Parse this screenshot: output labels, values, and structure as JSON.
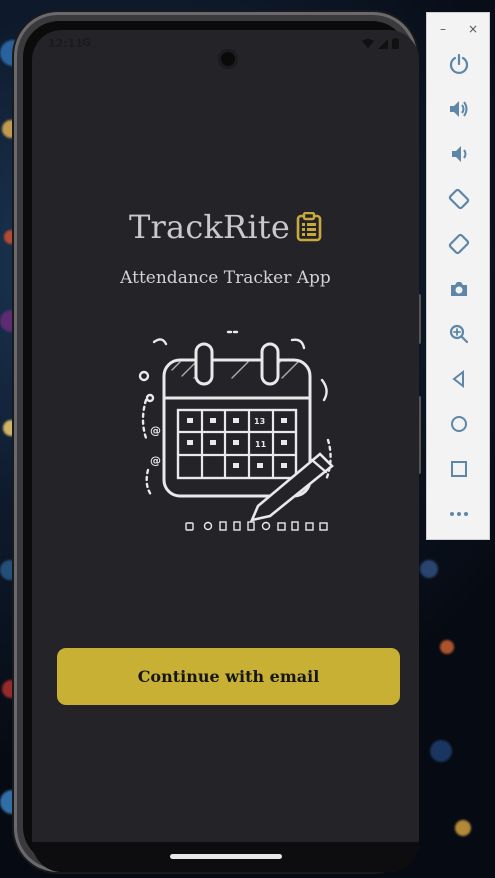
{
  "status": {
    "time": "12:11",
    "g_label": "G"
  },
  "app": {
    "title": "TrackRite",
    "subtitle": "Attendance Tracker App",
    "cta_label": "Continue with email",
    "calendar_numbers": [
      "13",
      "11"
    ]
  },
  "emulator": {
    "minimize_label": "–",
    "close_label": "×",
    "controls": [
      "power-icon",
      "volume-up-icon",
      "volume-down-icon",
      "rotate-left-icon",
      "rotate-right-icon",
      "camera-icon",
      "zoom-icon",
      "back-icon",
      "home-icon",
      "overview-icon",
      "more-icon"
    ]
  },
  "colors": {
    "screen_bg": "#232328",
    "accent": "#c8b035",
    "logo_icon": "#c8aa3c",
    "emulator_icon": "#5e86a8"
  }
}
